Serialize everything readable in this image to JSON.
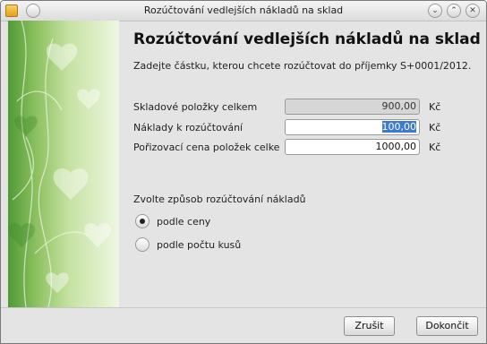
{
  "window": {
    "title": "Rozúčtování vedlejších nákladů na sklad",
    "minimize_glyph": "⌄",
    "maximize_glyph": "⌃",
    "close_glyph": "✕"
  },
  "header": {
    "title": "Rozúčtování vedlejších nákladů na sklad",
    "subtitle": "Zadejte částku, kterou chcete rozúčtovat do příjemky S+0001/2012."
  },
  "form": {
    "rows": [
      {
        "label": "Skladové položky celkem",
        "value": "900,00",
        "unit": "Kč"
      },
      {
        "label": "Náklady k rozúčtování",
        "value": "100,00",
        "unit": "Kč"
      },
      {
        "label": "Pořizovací cena položek celkem",
        "value": "1000,00",
        "unit": "Kč"
      }
    ]
  },
  "distribution": {
    "label": "Zvolte způsob rozúčtování nákladů",
    "options": [
      {
        "label": "podle ceny",
        "selected": true
      },
      {
        "label": "podle počtu kusů",
        "selected": false
      }
    ]
  },
  "buttons": {
    "cancel": "Zrušit",
    "finish": "Dokončit"
  },
  "colors": {
    "sidebar_green": "#6fae48",
    "selection": "#3d7bd0"
  }
}
